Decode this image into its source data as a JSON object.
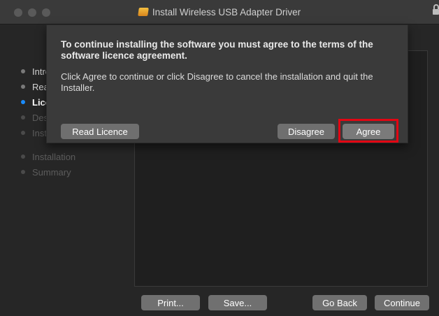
{
  "window": {
    "title": "Install Wireless USB Adapter Driver",
    "traffic_lights": [
      "close",
      "minimize",
      "zoom"
    ]
  },
  "sidebar": {
    "steps": [
      {
        "label": "Introduction",
        "state": "done"
      },
      {
        "label": "Read Me",
        "state": "done"
      },
      {
        "label": "Licence",
        "state": "current"
      },
      {
        "label": "Destination Select",
        "state": "pending"
      },
      {
        "label": "Installation Type",
        "state": "pending"
      },
      {
        "label": "Installation",
        "state": "pending"
      },
      {
        "label": "Summary",
        "state": "pending"
      }
    ]
  },
  "dialog": {
    "title": "To continue installing the software you must agree to the terms of the software licence agreement.",
    "message": "Click Agree to continue or click Disagree to cancel the installation and quit the Installer.",
    "read_licence_label": "Read Licence",
    "disagree_label": "Disagree",
    "agree_label": "Agree"
  },
  "footer": {
    "print_label": "Print...",
    "save_label": "Save...",
    "go_back_label": "Go Back",
    "continue_label": "Continue"
  },
  "colors": {
    "current_step_dot": "#1a8cff",
    "highlight_border": "#e30613",
    "button_bg": "#707070"
  }
}
